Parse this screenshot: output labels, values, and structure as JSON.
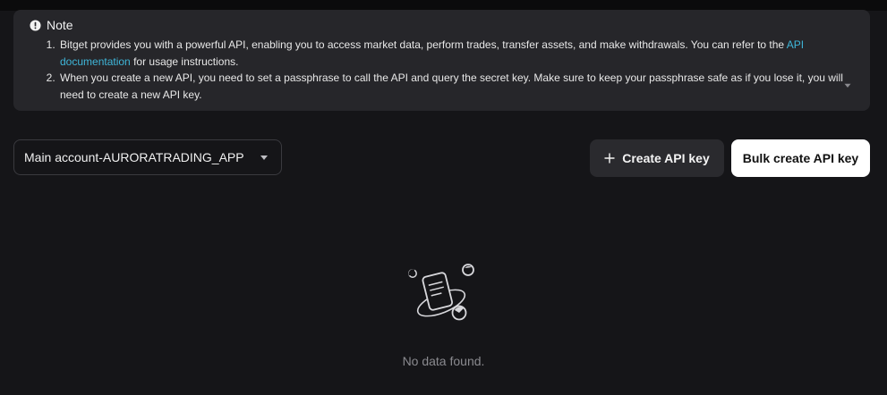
{
  "note": {
    "title": "Note",
    "items": [
      {
        "text_before": "Bitget provides you with a powerful API, enabling you to access market data, perform trades, transfer assets, and make withdrawals. You can refer to the ",
        "link": "API documentation",
        "text_after": " for usage instructions."
      },
      {
        "text": "When you create a new API, you need to set a passphrase to call the API and query the secret key. Make sure to keep your passphrase safe as if you lose it, you will need to create a new API key."
      }
    ]
  },
  "account_select": {
    "value": "Main account-AURORATRADING_APP"
  },
  "buttons": {
    "create": "Create API key",
    "bulk": "Bulk create API key"
  },
  "empty_state": {
    "message": "No data found."
  },
  "icons": {
    "note": "info-circle-icon",
    "expand": "chevron-down-icon",
    "select": "caret-down-icon",
    "create": "plus-icon",
    "empty": "empty-document-icon"
  },
  "colors": {
    "background": "#151518",
    "panel": "#26262a",
    "link": "#3fb6d9",
    "primary_button": "#ffffff",
    "secondary_button": "#2a2a2e",
    "muted_text": "#8a8a8f"
  }
}
